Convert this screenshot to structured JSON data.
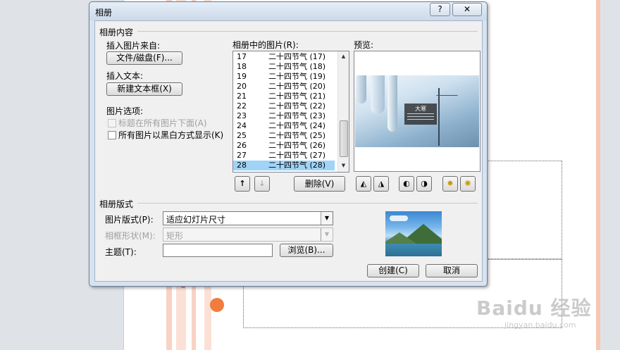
{
  "dialog": {
    "title": "相册",
    "help_label": "?",
    "close_label": "✕",
    "section_content": "相册内容",
    "insert_picture_from": "插入图片来自:",
    "file_disk_button": "文件/磁盘(F)...",
    "insert_text": "插入文本:",
    "new_textbox_button": "新建文本框(X)",
    "picture_options": "图片选项:",
    "captions_below": "标题在所有图片下面(A)",
    "all_black_white": "所有图片以黑白方式显示(K)",
    "pictures_in_album": "相册中的图片(R):",
    "pictures": [
      {
        "num": "17",
        "name": "二十四节气 (17)"
      },
      {
        "num": "18",
        "name": "二十四节气 (18)"
      },
      {
        "num": "19",
        "name": "二十四节气 (19)"
      },
      {
        "num": "20",
        "name": "二十四节气 (20)"
      },
      {
        "num": "21",
        "name": "二十四节气 (21)"
      },
      {
        "num": "22",
        "name": "二十四节气 (22)"
      },
      {
        "num": "23",
        "name": "二十四节气 (23)"
      },
      {
        "num": "24",
        "name": "二十四节气 (24)"
      },
      {
        "num": "25",
        "name": "二十四节气 (25)"
      },
      {
        "num": "26",
        "name": "二十四节气 (26)"
      },
      {
        "num": "27",
        "name": "二十四节气 (27)"
      },
      {
        "num": "28",
        "name": "二十四节气 (28)"
      }
    ],
    "selected_picture": "28",
    "move_up_icon": "↑",
    "move_down_icon": "↓",
    "delete_button": "删除(V)",
    "preview_label": "预览:",
    "preview_slide_title": "大寒",
    "section_layout": "相册版式",
    "picture_layout_label": "图片版式(P):",
    "picture_layout_value": "适应幻灯片尺寸",
    "frame_shape_label": "相框形状(M):",
    "frame_shape_value": "矩形",
    "theme_label": "主题(T):",
    "theme_value": "",
    "browse_button": "浏览(B)...",
    "create_button": "创建(C)",
    "cancel_button": "取消"
  },
  "background": {
    "watermark": "Baidu 经验",
    "watermark_sub": "jingyan.baidu.com"
  },
  "colors": {
    "selection": "#9fd3f7",
    "accent_orange": "#f07d3e",
    "dialog_frame": "#d7e3f1"
  }
}
